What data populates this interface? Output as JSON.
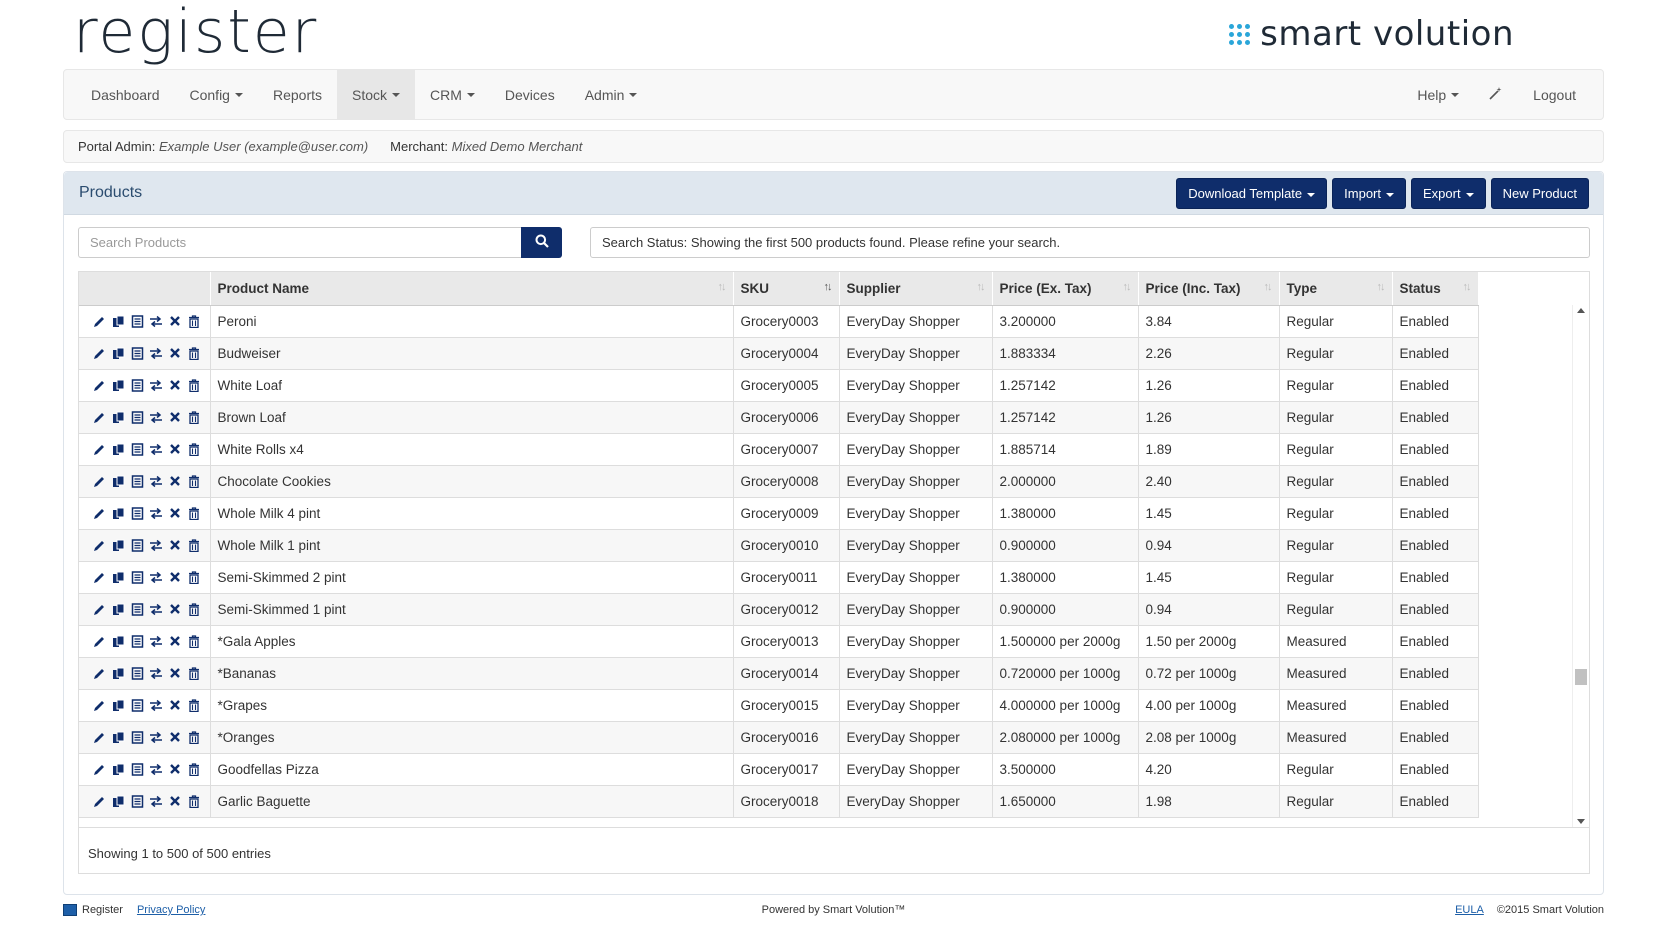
{
  "brand": {
    "left_logo": "register",
    "right_logo": "smart volution"
  },
  "nav": {
    "left": [
      {
        "label": "Dashboard",
        "caret": false,
        "active": false
      },
      {
        "label": "Config",
        "caret": true,
        "active": false
      },
      {
        "label": "Reports",
        "caret": false,
        "active": false
      },
      {
        "label": "Stock",
        "caret": true,
        "active": true
      },
      {
        "label": "CRM",
        "caret": true,
        "active": false
      },
      {
        "label": "Devices",
        "caret": false,
        "active": false
      },
      {
        "label": "Admin",
        "caret": true,
        "active": false
      }
    ],
    "help_label": "Help",
    "wand_icon": "magic-wand-icon",
    "logout_label": "Logout"
  },
  "adminbar": {
    "portal_admin_label": "Portal Admin:",
    "portal_admin_value": "Example User (example@user.com)",
    "merchant_label": "Merchant:",
    "merchant_value": "Mixed Demo Merchant"
  },
  "panel": {
    "title": "Products",
    "buttons": {
      "download_template": "Download Template",
      "import": "Import",
      "export": "Export",
      "new_product": "New Product"
    },
    "search_placeholder": "Search Products",
    "search_status": "Search Status: Showing the first 500 products found. Please refine your search."
  },
  "table": {
    "columns": [
      "",
      "Product Name",
      "SKU",
      "Supplier",
      "Price (Ex. Tax)",
      "Price (Inc. Tax)",
      "Type",
      "Status"
    ],
    "action_icons": [
      "edit-icon",
      "copy-icon",
      "details-icon",
      "transfer-icon",
      "remove-icon",
      "delete-icon"
    ],
    "rows": [
      [
        "Peroni",
        "Grocery0003",
        "EveryDay Shopper",
        "3.200000",
        "3.84",
        "Regular",
        "Enabled"
      ],
      [
        "Budweiser",
        "Grocery0004",
        "EveryDay Shopper",
        "1.883334",
        "2.26",
        "Regular",
        "Enabled"
      ],
      [
        "White Loaf",
        "Grocery0005",
        "EveryDay Shopper",
        "1.257142",
        "1.26",
        "Regular",
        "Enabled"
      ],
      [
        "Brown Loaf",
        "Grocery0006",
        "EveryDay Shopper",
        "1.257142",
        "1.26",
        "Regular",
        "Enabled"
      ],
      [
        "White Rolls x4",
        "Grocery0007",
        "EveryDay Shopper",
        "1.885714",
        "1.89",
        "Regular",
        "Enabled"
      ],
      [
        "Chocolate Cookies",
        "Grocery0008",
        "EveryDay Shopper",
        "2.000000",
        "2.40",
        "Regular",
        "Enabled"
      ],
      [
        "Whole Milk 4 pint",
        "Grocery0009",
        "EveryDay Shopper",
        "1.380000",
        "1.45",
        "Regular",
        "Enabled"
      ],
      [
        "Whole Milk 1 pint",
        "Grocery0010",
        "EveryDay Shopper",
        "0.900000",
        "0.94",
        "Regular",
        "Enabled"
      ],
      [
        "Semi-Skimmed 2 pint",
        "Grocery0011",
        "EveryDay Shopper",
        "1.380000",
        "1.45",
        "Regular",
        "Enabled"
      ],
      [
        "Semi-Skimmed 1 pint",
        "Grocery0012",
        "EveryDay Shopper",
        "0.900000",
        "0.94",
        "Regular",
        "Enabled"
      ],
      [
        "*Gala Apples",
        "Grocery0013",
        "EveryDay Shopper",
        "1.500000 per 2000g",
        "1.50 per 2000g",
        "Measured",
        "Enabled"
      ],
      [
        "*Bananas",
        "Grocery0014",
        "EveryDay Shopper",
        "0.720000 per 1000g",
        "0.72 per 1000g",
        "Measured",
        "Enabled"
      ],
      [
        "*Grapes",
        "Grocery0015",
        "EveryDay Shopper",
        "4.000000 per 1000g",
        "4.00 per 1000g",
        "Measured",
        "Enabled"
      ],
      [
        "*Oranges",
        "Grocery0016",
        "EveryDay Shopper",
        "2.080000 per 1000g",
        "2.08 per 1000g",
        "Measured",
        "Enabled"
      ],
      [
        "Goodfellas Pizza",
        "Grocery0017",
        "EveryDay Shopper",
        "3.500000",
        "4.20",
        "Regular",
        "Enabled"
      ],
      [
        "Garlic Baguette",
        "Grocery0018",
        "EveryDay Shopper",
        "1.650000",
        "1.98",
        "Regular",
        "Enabled"
      ]
    ],
    "sorted_column": "SKU",
    "scroll_position": 0.73,
    "info": "Showing 1 to 500 of 500 entries"
  },
  "footer": {
    "register_label": "Register",
    "privacy_label": "Privacy Policy",
    "powered_by": "Powered by Smart Volution™",
    "eula_label": "EULA",
    "copyright": "©2015 Smart Volution"
  },
  "colors": {
    "primary_button": "#0f2d6b",
    "panel_heading": "#dfe7ef",
    "accent_dots": "#2aa6d9"
  }
}
